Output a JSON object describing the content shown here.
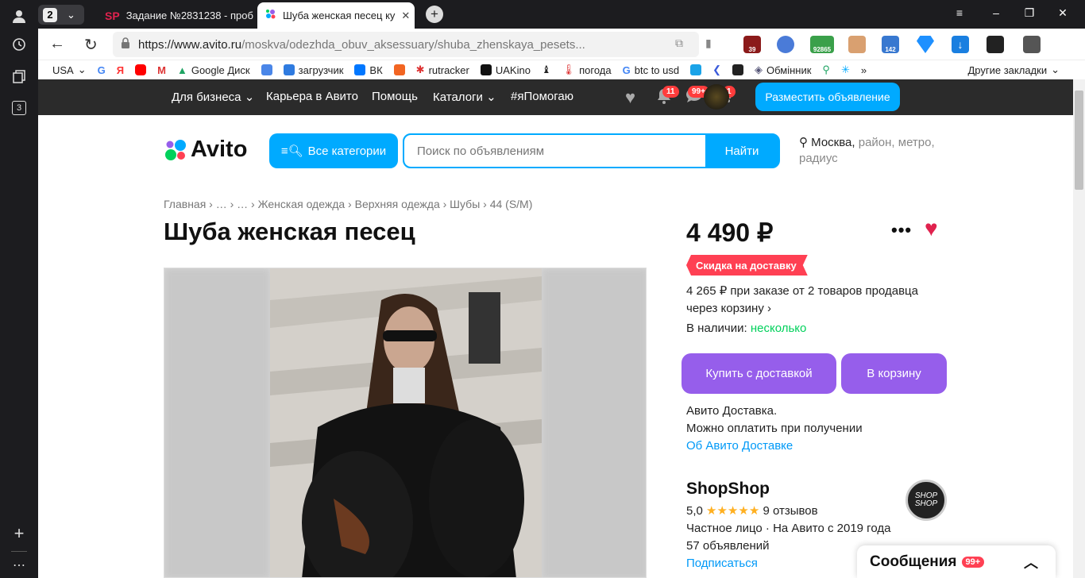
{
  "rail": {
    "tab_count_badge": "3"
  },
  "tabs": {
    "count": "2",
    "items": [
      {
        "favicon": "SP",
        "label": "Задание №2831238 - проб"
      },
      {
        "favicon": "●",
        "label": "Шуба женская песец ку"
      }
    ]
  },
  "address": {
    "host": "https://www.avito.ru",
    "path": "/moskva/odezhda_obuv_aksessuary/shuba_zhenskaya_pesets..."
  },
  "extensions": {
    "ext1": "39",
    "ext2": "92865",
    "ext3": "142"
  },
  "bookmarks": {
    "items": [
      "USA",
      "Google Диск",
      "загрузчик",
      "ВК",
      "rutracker",
      "UAKino",
      "погода",
      "btc to usd",
      "Обмінник"
    ],
    "other": "Другие закладки"
  },
  "avito_top": {
    "nav": [
      "Для бизнеса",
      "Карьера в Авито",
      "Помощь",
      "Каталоги",
      "#яПомогаю"
    ],
    "notif_badge": "11",
    "messages_badge": "99+",
    "cart_badge": "1",
    "post_button": "Разместить объявление"
  },
  "header": {
    "logo": "Avito",
    "categories_button": "Все категории",
    "search_placeholder": "Поиск по объявлениям",
    "search_button": "Найти",
    "location_city": "Москва,",
    "location_rest": " район, метро, радиус"
  },
  "listing": {
    "breadcrumbs": "Главная › … › … › Женская одежда › Верхняя одежда › Шубы › 44 (S/M)",
    "title": "Шуба женская песец",
    "price": "4 490 ₽",
    "discount_label": "Скидка на доставку",
    "multi_price_line1": "4 265 ₽ при заказе от 2 товаров продавца",
    "multi_price_line2": "через корзину ›",
    "stock_label": "В наличии:",
    "stock_value": "несколько",
    "buy_button": "Купить с доставкой",
    "cart_button": "В корзину",
    "delivery_line1": "Авито Доставка.",
    "delivery_line2": "Можно оплатить при получении",
    "delivery_link": "Об Авито Доставке"
  },
  "seller": {
    "name": "ShopShop",
    "rating": "5,0",
    "stars": "★★★★★",
    "reviews": "9 отзывов",
    "type": "Частное лицо · На Авито с 2019 года",
    "ads": "57 объявлений",
    "subscribe": "Подписаться",
    "logo_text": "SHOP SHOP"
  },
  "messages": {
    "label": "Сообщения",
    "badge": "99+"
  }
}
